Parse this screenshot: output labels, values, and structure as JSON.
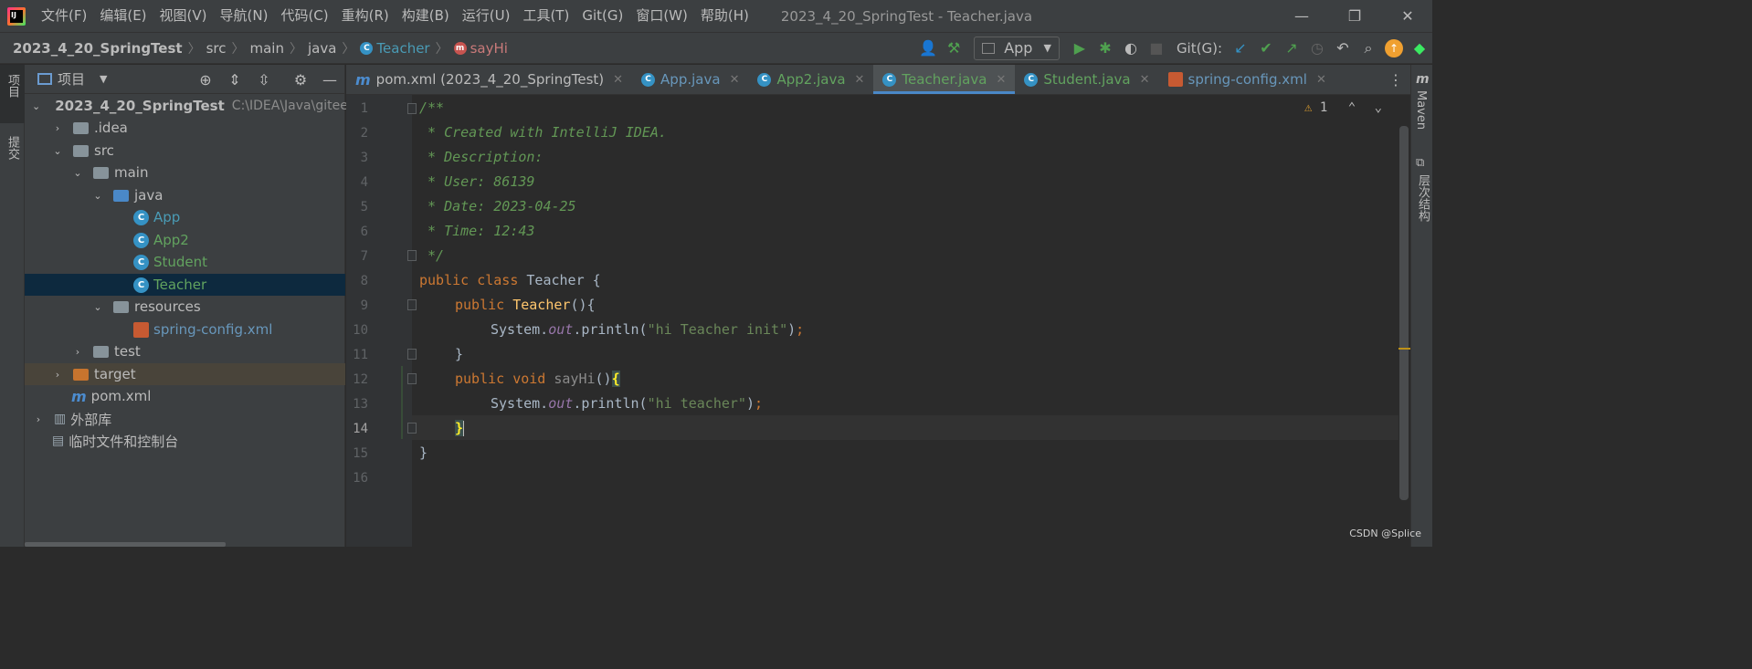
{
  "menubar": {
    "items": [
      "文件(F)",
      "编辑(E)",
      "视图(V)",
      "导航(N)",
      "代码(C)",
      "重构(R)",
      "构建(B)",
      "运行(U)",
      "工具(T)",
      "Git(G)",
      "窗口(W)",
      "帮助(H)"
    ],
    "window_title": "2023_4_20_SpringTest - Teacher.java",
    "minimize": "—",
    "restore": "❐",
    "close": "✕"
  },
  "navbar": {
    "crumbs": [
      "2023_4_20_SpringTest",
      "src",
      "main",
      "java",
      "Teacher",
      "sayHi"
    ],
    "run_config": "App",
    "git_label": "Git(G):"
  },
  "left_strip": {
    "project_tab": "项目",
    "commit_tab": "提交"
  },
  "right_strip": {
    "maven_tab": "Maven",
    "structure_tab": "层次结构"
  },
  "project_panel": {
    "title": "项目",
    "tree": [
      {
        "label": "2023_4_20_SpringTest",
        "path": "C:\\IDEA\\Java\\gitee"
      },
      {
        "label": ".idea"
      },
      {
        "label": "src"
      },
      {
        "label": "main"
      },
      {
        "label": "java"
      },
      {
        "label": "App"
      },
      {
        "label": "App2"
      },
      {
        "label": "Student"
      },
      {
        "label": "Teacher"
      },
      {
        "label": "resources"
      },
      {
        "label": "spring-config.xml"
      },
      {
        "label": "test"
      },
      {
        "label": "target"
      },
      {
        "label": "pom.xml"
      },
      {
        "label": "外部库"
      },
      {
        "label": "临时文件和控制台"
      }
    ]
  },
  "tabs": [
    {
      "label": "pom.xml (2023_4_20_SpringTest)",
      "icon": "maven-icon"
    },
    {
      "label": "App.java",
      "icon": "class-icon"
    },
    {
      "label": "App2.java",
      "icon": "class-icon"
    },
    {
      "label": "Teacher.java",
      "icon": "class-icon",
      "active": true
    },
    {
      "label": "Student.java",
      "icon": "class-icon"
    },
    {
      "label": "spring-config.xml",
      "icon": "xml-icon"
    }
  ],
  "editor": {
    "warning_count": "1",
    "line_numbers": [
      "1",
      "2",
      "3",
      "4",
      "5",
      "6",
      "7",
      "8",
      "9",
      "10",
      "11",
      "12",
      "13",
      "14",
      "15",
      "16"
    ],
    "current_line": "14",
    "code": {
      "l1": "/**",
      "l2": " * Created with IntelliJ IDEA.",
      "l3": " * Description:",
      "l4": " * User: 86139",
      "l5": " * Date: 2023-04-25",
      "l6": " * Time: 12:43",
      "l7": " */",
      "l8_kw1": "public",
      "l8_kw2": "class",
      "l8_name": " Teacher {",
      "l9_kw": "public",
      "l9_fn": "Teacher",
      "l9_rest": "(){",
      "l10_a": "System.",
      "l10_fld": "out",
      "l10_b": ".println(",
      "l10_str": "\"hi Teacher init\"",
      "l10_c": ")",
      "l10_semi": ";",
      "l11": "}",
      "l12_kw1": "public",
      "l12_kw2": "void",
      "l12_fn": "sayHi",
      "l12_paren": "()",
      "l12_brace": "{",
      "l13_a": "System.",
      "l13_fld": "out",
      "l13_b": ".println(",
      "l13_str": "\"hi teacher\"",
      "l13_c": ")",
      "l13_semi": ";",
      "l14_brace": "}",
      "l15": "}"
    }
  },
  "watermark": "CSDN @Splice",
  "colors": {
    "accent": "#4a88c7",
    "keyword": "#cc7832",
    "comment": "#629755",
    "string": "#6a8759",
    "function": "#ffc66d"
  }
}
